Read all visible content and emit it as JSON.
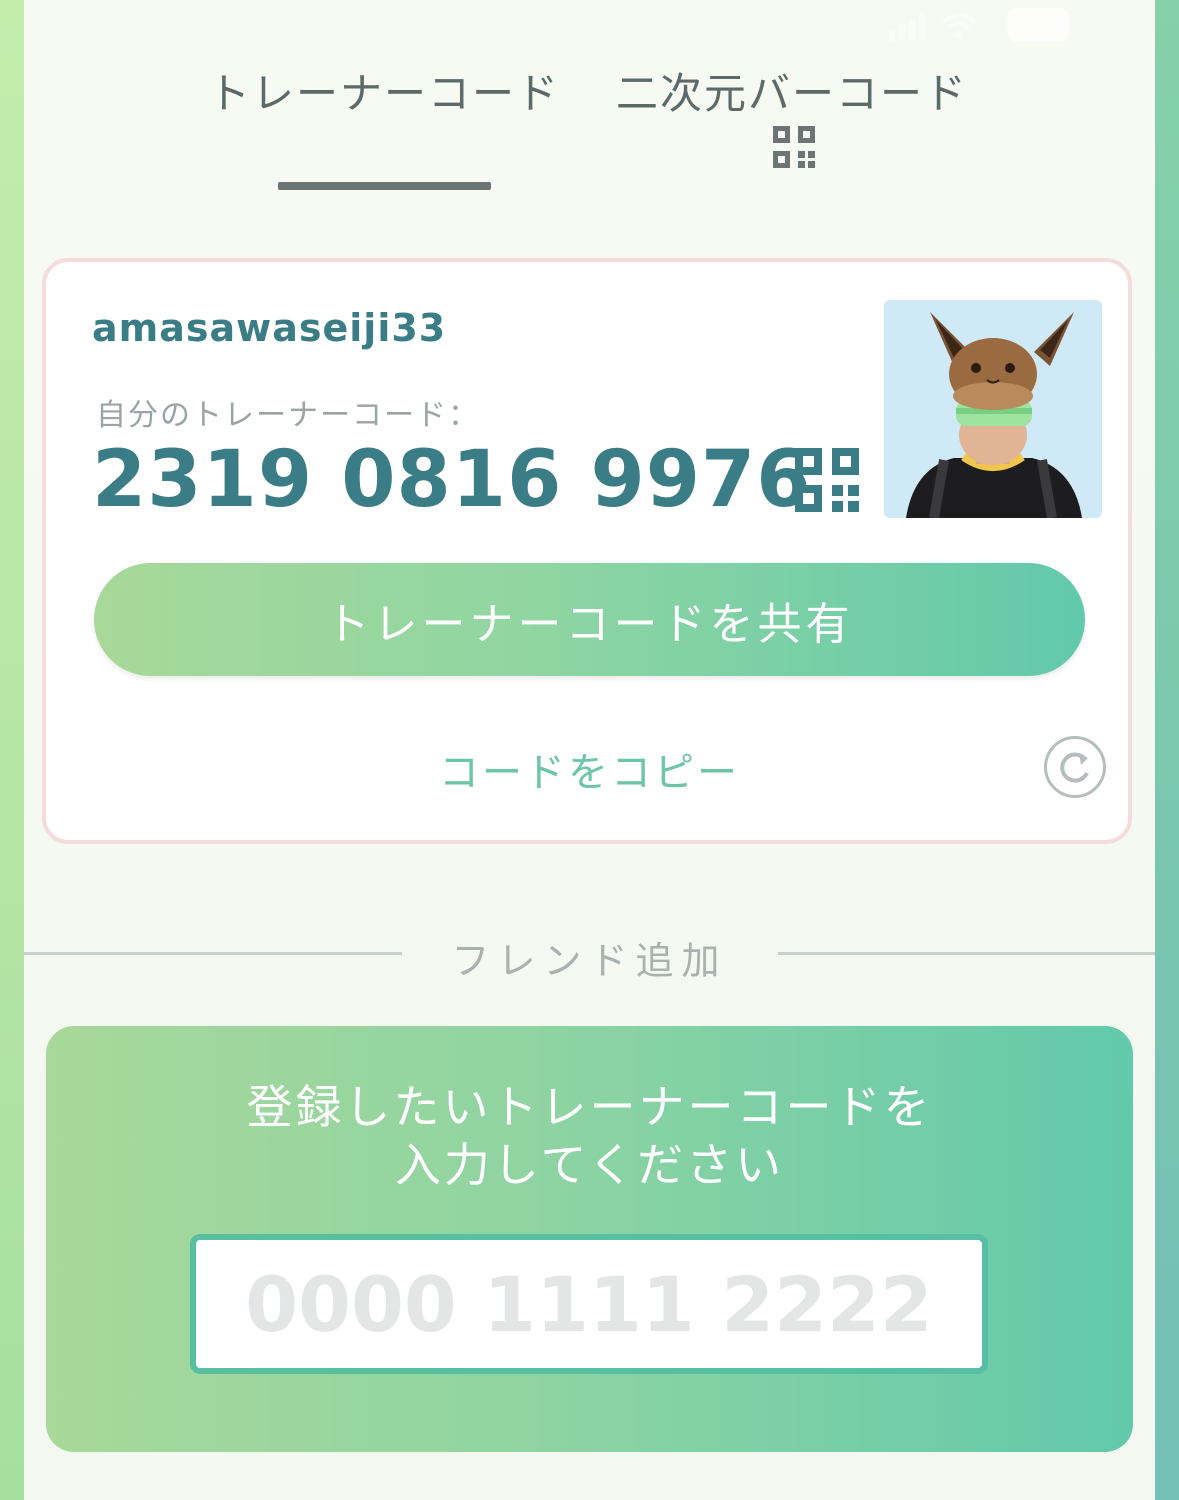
{
  "tabs": [
    {
      "label": "トレーナーコード",
      "active": true
    },
    {
      "label": "二次元バーコード",
      "active": false,
      "icon": "qr-code-icon"
    }
  ],
  "card": {
    "username": "amasawaseiji33",
    "code_label": "自分のトレーナーコード：",
    "trainer_code": "2319 0816 9976",
    "share_button": "トレーナーコードを共有",
    "copy_button": "コードをコピー"
  },
  "friend": {
    "divider_label": "フレンド追加",
    "prompt_line1": "登録したいトレーナーコードを",
    "prompt_line2": "入力してください",
    "input_placeholder": "0000 1111 2222",
    "input_value": ""
  },
  "colors": {
    "accent_teal": "#3b7d86",
    "button_gradient_start": "#a8d89a",
    "button_gradient_end": "#62c9ab",
    "copy_text": "#6bc5a6"
  }
}
